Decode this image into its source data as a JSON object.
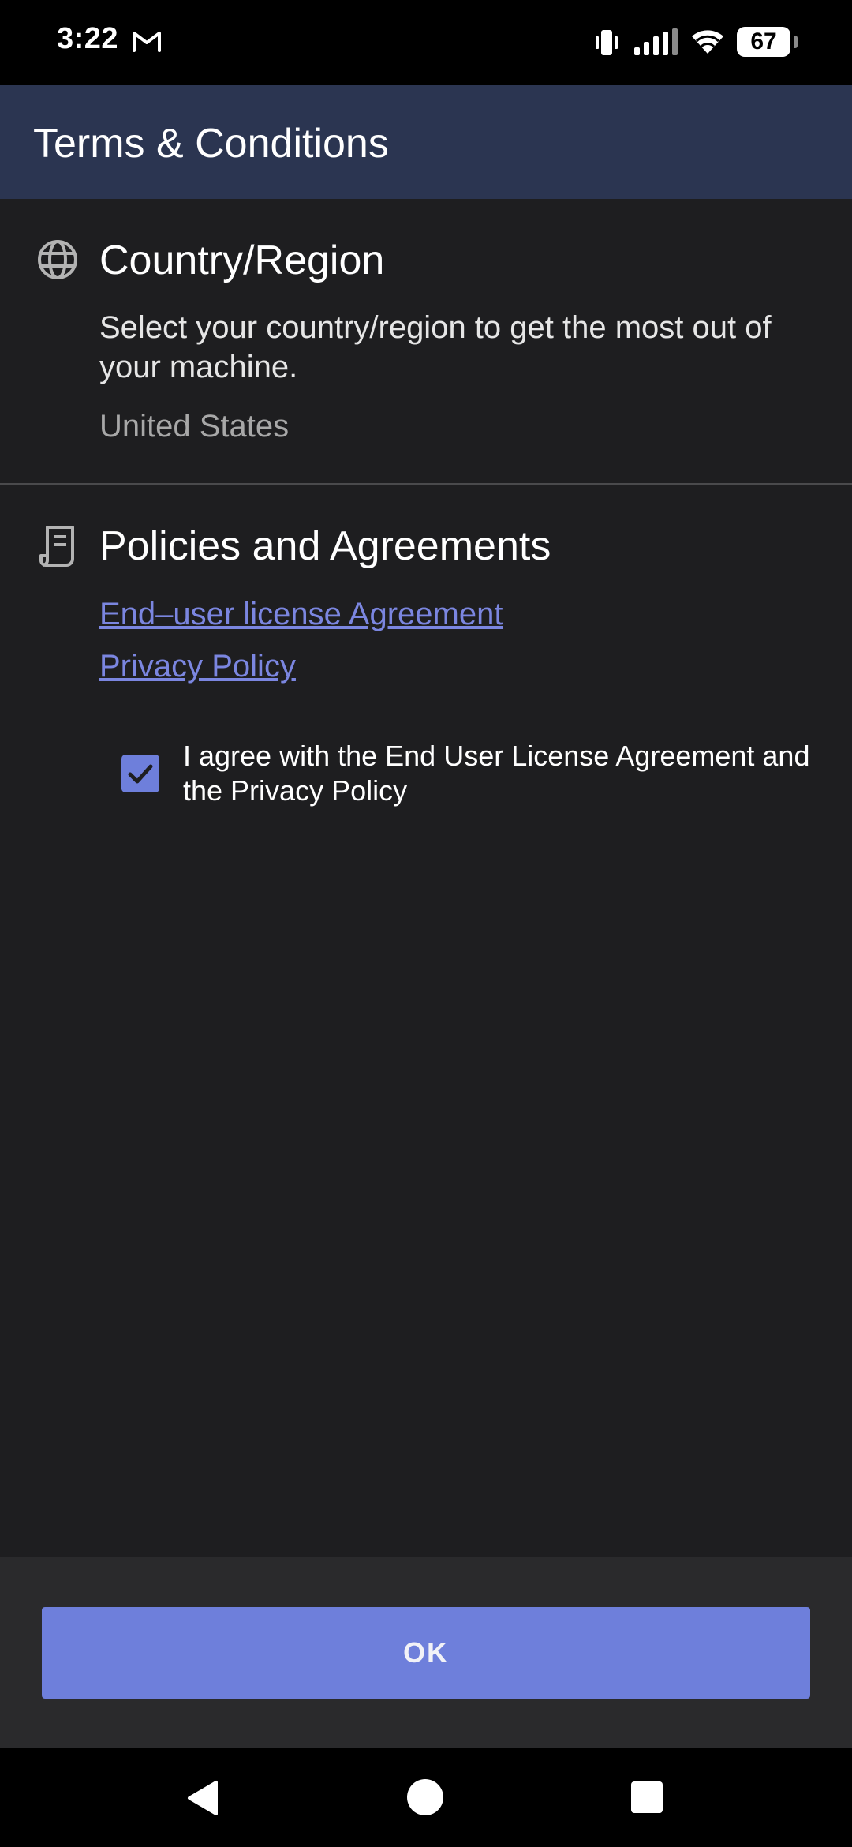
{
  "status_bar": {
    "time": "3:22",
    "battery_level": "67"
  },
  "app_bar": {
    "title": "Terms & Conditions"
  },
  "country_section": {
    "icon": "globe-icon",
    "title": "Country/Region",
    "description": "Select your country/region to get the most out of your machine.",
    "selected_country": "United States"
  },
  "policies_section": {
    "icon": "document-icon",
    "title": "Policies and Agreements",
    "links": [
      {
        "label": "End–user license Agreement"
      },
      {
        "label": "Privacy Policy"
      }
    ]
  },
  "agreement": {
    "checked": true,
    "label": "I agree with the End User License Agreement and the Privacy Policy"
  },
  "footer": {
    "ok_label": "OK"
  },
  "colors": {
    "accent": "#6e7fdb",
    "link": "#7b86e0",
    "app_bar_bg": "#2b3551",
    "background": "#1e1e20"
  }
}
